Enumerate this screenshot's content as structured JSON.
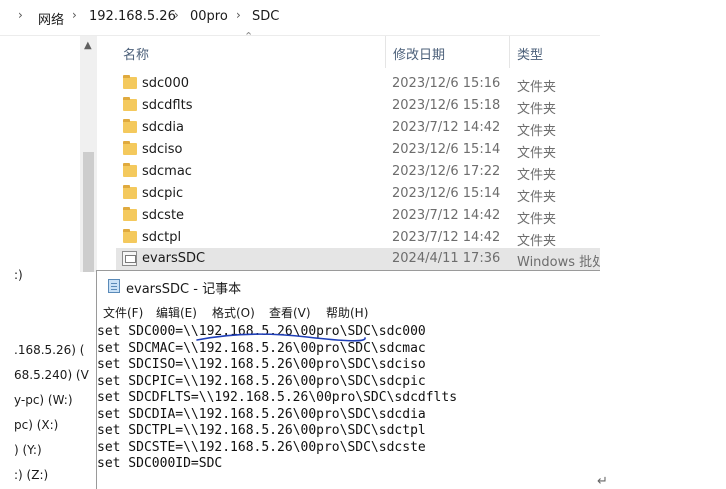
{
  "explorer": {
    "breadcrumb": [
      {
        "label": "网络"
      },
      {
        "label": "192.168.5.26"
      },
      {
        "label": "00pro"
      },
      {
        "label": "SDC"
      }
    ],
    "columns": {
      "name": "名称",
      "date": "修改日期",
      "type": "类型"
    },
    "files": [
      {
        "name": "sdc000",
        "date": "2023/12/6 15:16",
        "type": "文件夹",
        "icon": "folder-icon"
      },
      {
        "name": "sdcdflts",
        "date": "2023/12/6 15:18",
        "type": "文件夹",
        "icon": "folder-icon"
      },
      {
        "name": "sdcdia",
        "date": "2023/7/12 14:42",
        "type": "文件夹",
        "icon": "folder-icon"
      },
      {
        "name": "sdciso",
        "date": "2023/12/6 15:14",
        "type": "文件夹",
        "icon": "folder-icon"
      },
      {
        "name": "sdcmac",
        "date": "2023/12/6 17:22",
        "type": "文件夹",
        "icon": "folder-icon"
      },
      {
        "name": "sdcpic",
        "date": "2023/12/6 15:14",
        "type": "文件夹",
        "icon": "folder-icon"
      },
      {
        "name": "sdcste",
        "date": "2023/7/12 14:42",
        "type": "文件夹",
        "icon": "folder-icon"
      },
      {
        "name": "sdctpl",
        "date": "2023/7/12 14:42",
        "type": "文件夹",
        "icon": "folder-icon"
      },
      {
        "name": "evarsSDC",
        "date": "2024/4/11 17:36",
        "type": "Windows 批处理文件",
        "icon": "batch-file-icon",
        "selected": true
      }
    ],
    "nav_items": [
      {
        "label": ":)"
      },
      {
        "label": ".168.5.26) ("
      },
      {
        "label": "68.5.240) (V"
      },
      {
        "label": "y-pc) (W:)"
      },
      {
        "label": "pc) (X:)"
      },
      {
        "label": ") (Y:)"
      },
      {
        "label": ":) (Z:)"
      }
    ]
  },
  "notepad": {
    "title": "evarsSDC - 记事本",
    "menu": [
      {
        "label": "文件(F)"
      },
      {
        "label": "编辑(E)"
      },
      {
        "label": "格式(O)"
      },
      {
        "label": "查看(V)"
      },
      {
        "label": "帮助(H)"
      }
    ],
    "lines": [
      "set SDC000=\\\\192.168.5.26\\00pro\\SDC\\sdc000",
      "set SDCMAC=\\\\192.168.5.26\\00pro\\SDC\\sdcmac",
      "set SDCISO=\\\\192.168.5.26\\00pro\\SDC\\sdciso",
      "set SDCPIC=\\\\192.168.5.26\\00pro\\SDC\\sdcpic",
      "set SDCDFLTS=\\\\192.168.5.26\\00pro\\SDC\\sdcdflts",
      "set SDCDIA=\\\\192.168.5.26\\00pro\\SDC\\sdcdia",
      "set SDCTPL=\\\\192.168.5.26\\00pro\\SDC\\sdctpl",
      "set SDCSTE=\\\\192.168.5.26\\00pro\\SDC\\sdcste",
      "set SDC000ID=SDC"
    ],
    "annotation_color": "#1f3fb8"
  },
  "return_glyph": "↵"
}
